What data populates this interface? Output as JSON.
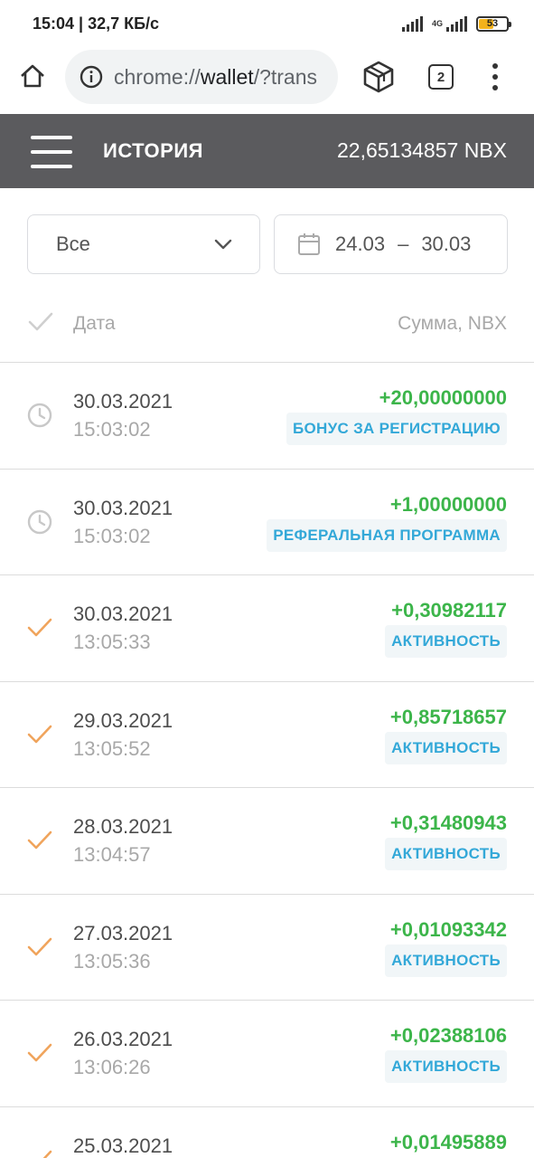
{
  "statusbar": {
    "time_speed": "15:04 | 32,7 КБ/с",
    "network": "4G",
    "battery": "53",
    "battery_level_percent": 53
  },
  "browser": {
    "url_prefix": "chrome://",
    "url_host": "wallet",
    "url_rest": "/?trans",
    "tab_count": "2"
  },
  "header": {
    "title": "ИСТОРИЯ",
    "balance": "22,65134857 NBX"
  },
  "filters": {
    "type_selected": "Все",
    "date_from": "24.03",
    "date_separator": "–",
    "date_to": "30.03"
  },
  "table": {
    "col_date": "Дата",
    "col_sum": "Сумма, NBX"
  },
  "colors": {
    "header_bg": "#5b5b5e",
    "amount_green": "#3cb54a",
    "badge_blue": "#33a8d8",
    "check_orange": "#f0a45c",
    "pending_gray": "#c8c8c8"
  },
  "transactions": [
    {
      "status_icon": "clock-icon",
      "date": "30.03.2021",
      "time": "15:03:02",
      "amount": "+20,00000000",
      "type": "БОНУС ЗА РЕГИСТРАЦИЮ"
    },
    {
      "status_icon": "clock-icon",
      "date": "30.03.2021",
      "time": "15:03:02",
      "amount": "+1,00000000",
      "type": "РЕФЕРАЛЬНАЯ ПРОГРАММА"
    },
    {
      "status_icon": "check-icon",
      "date": "30.03.2021",
      "time": "13:05:33",
      "amount": "+0,30982117",
      "type": "АКТИВНОСТЬ"
    },
    {
      "status_icon": "check-icon",
      "date": "29.03.2021",
      "time": "13:05:52",
      "amount": "+0,85718657",
      "type": "АКТИВНОСТЬ"
    },
    {
      "status_icon": "check-icon",
      "date": "28.03.2021",
      "time": "13:04:57",
      "amount": "+0,31480943",
      "type": "АКТИВНОСТЬ"
    },
    {
      "status_icon": "check-icon",
      "date": "27.03.2021",
      "time": "13:05:36",
      "amount": "+0,01093342",
      "type": "АКТИВНОСТЬ"
    },
    {
      "status_icon": "check-icon",
      "date": "26.03.2021",
      "time": "13:06:26",
      "amount": "+0,02388106",
      "type": "АКТИВНОСТЬ"
    },
    {
      "status_icon": "check-icon",
      "date": "25.03.2021",
      "time": "",
      "amount": "+0,01495889",
      "type": ""
    }
  ]
}
